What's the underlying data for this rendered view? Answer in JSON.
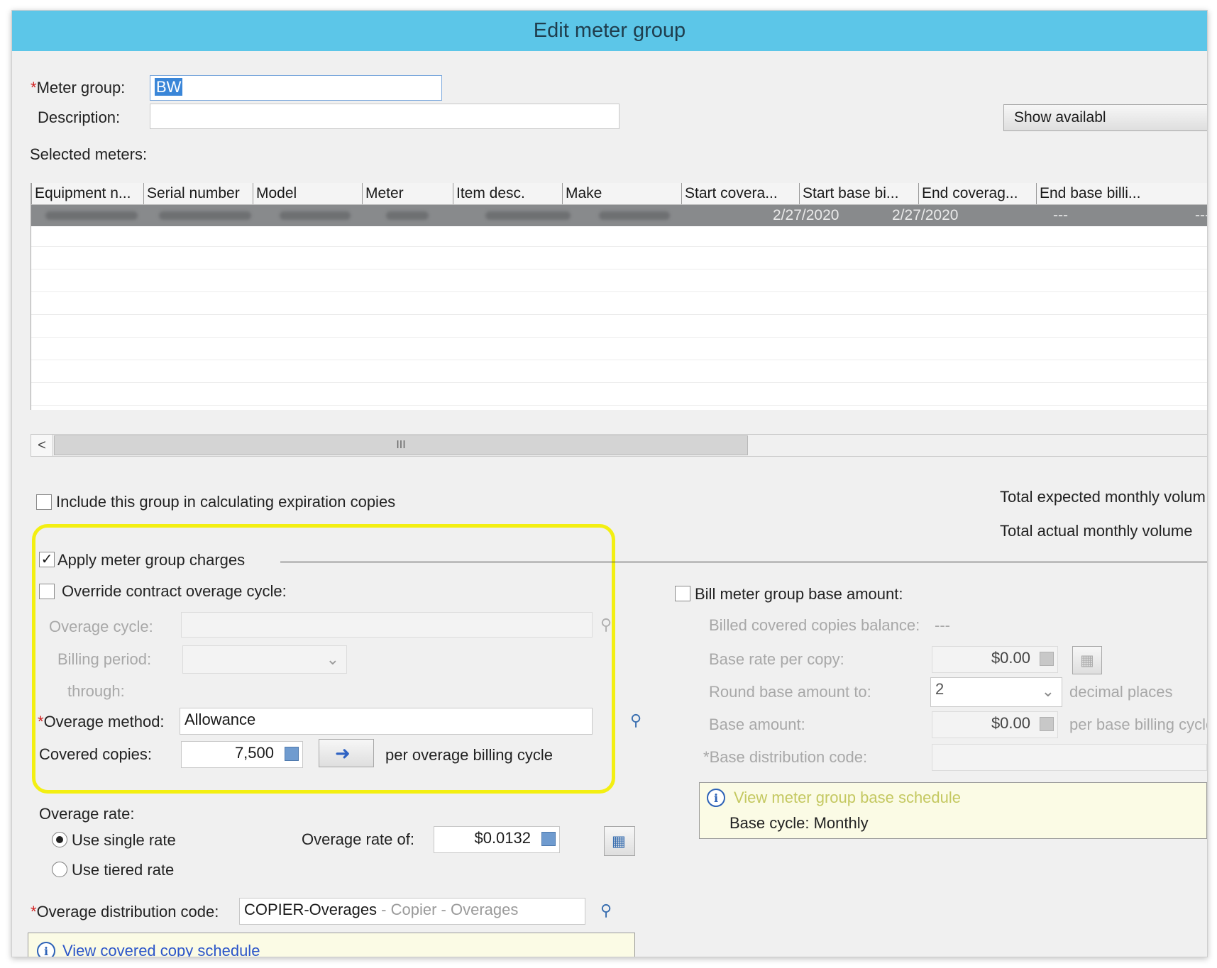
{
  "window": {
    "title": "Edit meter group"
  },
  "meter_group": {
    "label": "Meter group:",
    "required_mark": "*",
    "value": "BW"
  },
  "description": {
    "label": "Description:",
    "value": ""
  },
  "show_available_button": "Show availabl",
  "selected_meters": {
    "label": "Selected meters:",
    "columns": [
      "Equipment n...",
      "Serial number",
      "Model",
      "Meter",
      "Item desc.",
      "Make",
      "Start covera...",
      "Start base bi...",
      "End coverag...",
      "End base billi..."
    ],
    "rows": [
      {
        "start_coverage": "2/27/2020",
        "start_base_billing": "2/27/2020",
        "end_coverage": "---",
        "end_base_billing": "---"
      }
    ],
    "scroll_thumb_grip": "III",
    "scroll_left": "<"
  },
  "include_expiration": {
    "label": "Include this group in calculating expiration copies",
    "checked": false
  },
  "totals": {
    "expected": "Total expected monthly volum",
    "actual": "Total actual monthly volume"
  },
  "apply_charges": {
    "label": "Apply meter group charges",
    "checked": true
  },
  "override_cycle": {
    "label": "Override contract overage cycle:",
    "checked": false
  },
  "overage_cycle": {
    "label": "Overage cycle:",
    "value": ""
  },
  "billing_period": {
    "label": "Billing period:",
    "value": ""
  },
  "through": {
    "label": "through:"
  },
  "overage_method": {
    "label": "Overage method:",
    "required_mark": "*",
    "value": "Allowance"
  },
  "covered_copies": {
    "label": "Covered copies:",
    "value": "7,500",
    "suffix": "per overage billing cycle"
  },
  "overage_rate": {
    "label": "Overage rate:",
    "single": {
      "label": "Use single rate",
      "selected": true
    },
    "tiered": {
      "label": "Use tiered rate",
      "selected": false
    },
    "rate_of_label": "Overage rate of:",
    "rate_value": "$0.0132"
  },
  "overage_distribution": {
    "label": "Overage distribution code:",
    "required_mark": "*",
    "code": "COPIER-Overages",
    "desc": " - Copier - Overages"
  },
  "covered_schedule_link": "View covered copy schedule",
  "bill_base": {
    "label": "Bill meter group base amount:",
    "checked": false
  },
  "billed_balance": {
    "label": "Billed covered copies balance:",
    "value": "---"
  },
  "base_rate": {
    "label": "Base rate per copy:",
    "value": "$0.00"
  },
  "round_base": {
    "label": "Round base amount to:",
    "value": "2",
    "suffix": "decimal places"
  },
  "base_amount": {
    "label": "Base amount:",
    "value": "$0.00",
    "suffix": "per base billing cycle"
  },
  "base_distribution": {
    "label": "Base distribution code:",
    "required_mark": "*",
    "value": ""
  },
  "base_schedule": {
    "link": "View meter group base schedule",
    "cycle": "Base cycle: Monthly"
  }
}
